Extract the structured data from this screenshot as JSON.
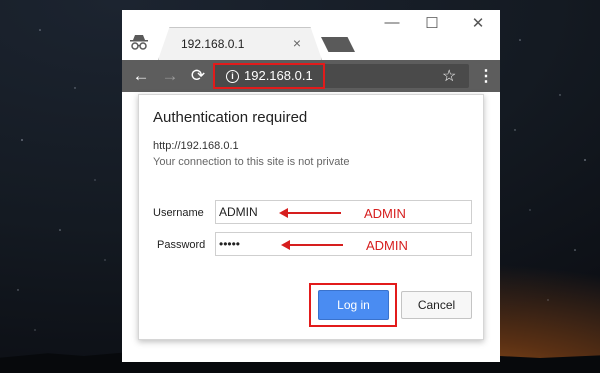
{
  "browser": {
    "tab_title": "192.168.0.1",
    "tab_close": "×",
    "minimize": "—",
    "maximize": "☐",
    "close": "✕",
    "back": "←",
    "forward": "→",
    "reload": "⟳",
    "url": "192.168.0.1",
    "info_glyph": "i",
    "bookmark_glyph": "☆",
    "menu_glyph": "⋮"
  },
  "dialog": {
    "title": "Authentication required",
    "site": "http://192.168.0.1",
    "warning": "Your connection to this site is not private",
    "username_label": "Username",
    "username_value": "ADMIN",
    "password_label": "Password",
    "password_value": "•••••",
    "login_label": "Log in",
    "cancel_label": "Cancel"
  },
  "annotations": {
    "username_note": "ADMIN",
    "password_note": "ADMIN",
    "color": "#d61e1e"
  }
}
